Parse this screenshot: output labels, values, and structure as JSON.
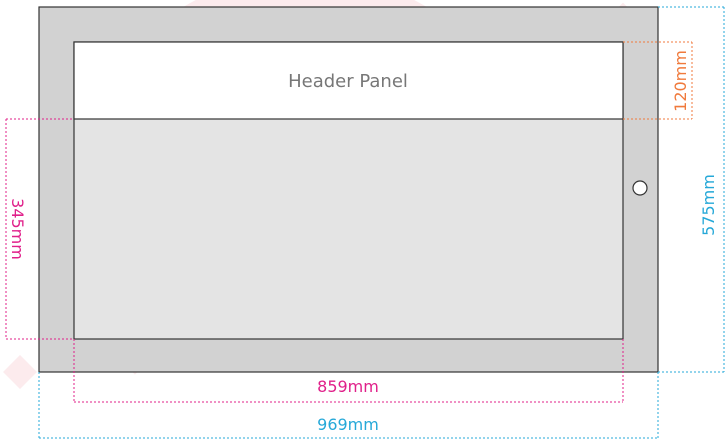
{
  "header_panel": {
    "label": "Header Panel"
  },
  "dimensions": {
    "header_height": "120mm",
    "overall_height": "575mm",
    "screen_height": "345mm",
    "screen_width": "859mm",
    "overall_width": "969mm"
  },
  "colors": {
    "bezel": "#d2d2d2",
    "screen": "#e4e4e4",
    "header": "#ffffff",
    "outline": "#333333",
    "dimension_orange": "#f07a3c",
    "dimension_cyan": "#25a8d8",
    "dimension_magenta": "#e0208a",
    "watermark": "#e03a4a"
  },
  "icons": {
    "home_button": "circle-button-icon"
  }
}
